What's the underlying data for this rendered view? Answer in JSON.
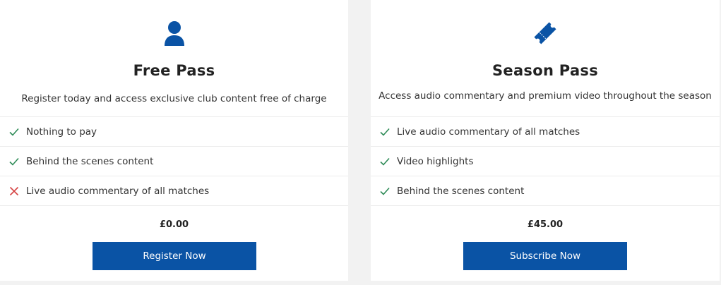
{
  "colors": {
    "brand_blue": "#0a53a5",
    "check_green": "#2e8b57",
    "cross_red": "#d64545"
  },
  "cards": [
    {
      "icon": "user-icon",
      "title": "Free Pass",
      "subtitle": "Register today and access exclusive club content free of charge",
      "features": [
        {
          "text": "Nothing to pay",
          "included": true,
          "mark_icon": "check-icon"
        },
        {
          "text": "Behind the scenes content",
          "included": true,
          "mark_icon": "check-icon"
        },
        {
          "text": "Live audio commentary of all matches",
          "included": false,
          "mark_icon": "cross-icon"
        }
      ],
      "price": "£0.00",
      "button_label": "Register Now"
    },
    {
      "icon": "ticket-icon",
      "title": "Season Pass",
      "subtitle": "Access audio commentary and premium video throughout the season",
      "features": [
        {
          "text": "Live audio commentary of all matches",
          "included": true,
          "mark_icon": "check-icon"
        },
        {
          "text": "Video highlights",
          "included": true,
          "mark_icon": "check-icon"
        },
        {
          "text": "Behind the scenes content",
          "included": true,
          "mark_icon": "check-icon"
        }
      ],
      "price": "£45.00",
      "button_label": "Subscribe Now"
    }
  ]
}
